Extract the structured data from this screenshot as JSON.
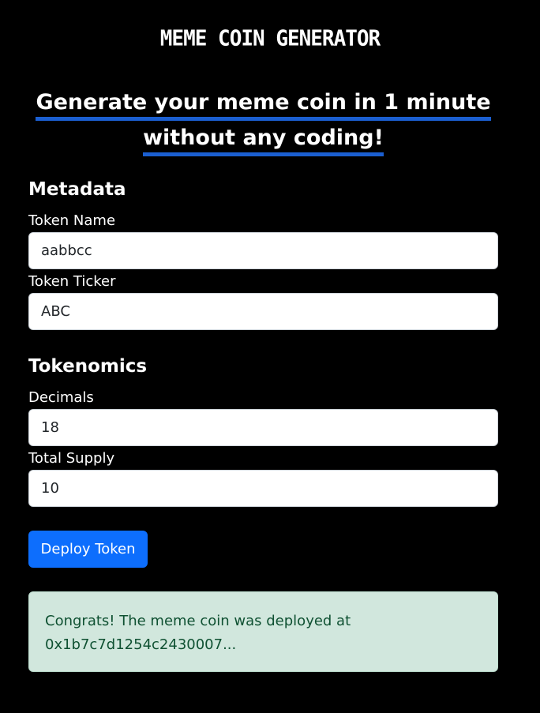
{
  "header": {
    "app_title": "MEME COIN GENERATOR",
    "headline_line1": "Generate your meme coin in 1 minute",
    "headline_line2": "without any coding!"
  },
  "metadata": {
    "heading": "Metadata",
    "token_name_label": "Token Name",
    "token_name_value": "aabbcc",
    "token_ticker_label": "Token Ticker",
    "token_ticker_value": "ABC"
  },
  "tokenomics": {
    "heading": "Tokenomics",
    "decimals_label": "Decimals",
    "decimals_value": "18",
    "total_supply_label": "Total Supply",
    "total_supply_value": "10"
  },
  "actions": {
    "deploy_label": "Deploy Token"
  },
  "result": {
    "message_line1": "Congrats! The meme coin was deployed at",
    "message_line2": "0x1b7c7d1254c2430007..."
  },
  "colors": {
    "background": "#000000",
    "accent_underline": "#1b5fd1",
    "primary_button": "#0d6efd",
    "success_background": "#d1e7dd",
    "success_text": "#0f5132"
  }
}
